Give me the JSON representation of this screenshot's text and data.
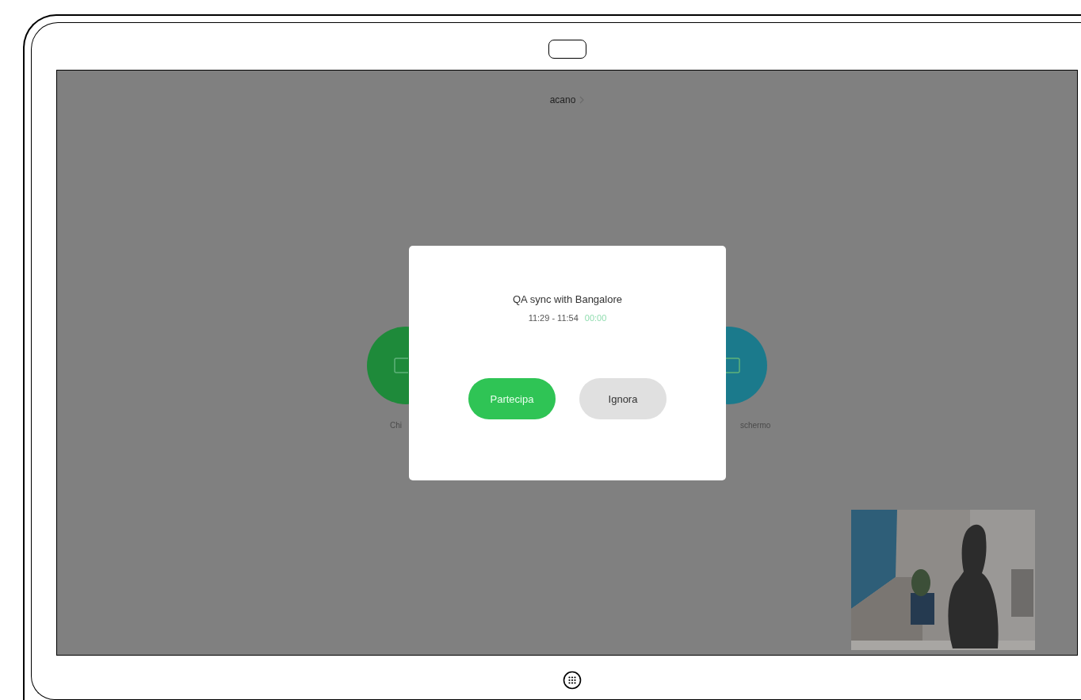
{
  "header": {
    "title": "acano"
  },
  "background_buttons": [
    {
      "label": "Chi",
      "color": "#1e8a3a"
    },
    {
      "label": "schermo",
      "color": "#1b7a8c"
    }
  ],
  "dialog": {
    "title": "QA sync with Bangalore",
    "time": "11:29 - 11:54",
    "countdown": "00:00",
    "buttons": [
      {
        "label": "Partecipa",
        "kind": "primary"
      },
      {
        "label": "Ignora",
        "kind": "secondary"
      }
    ]
  }
}
